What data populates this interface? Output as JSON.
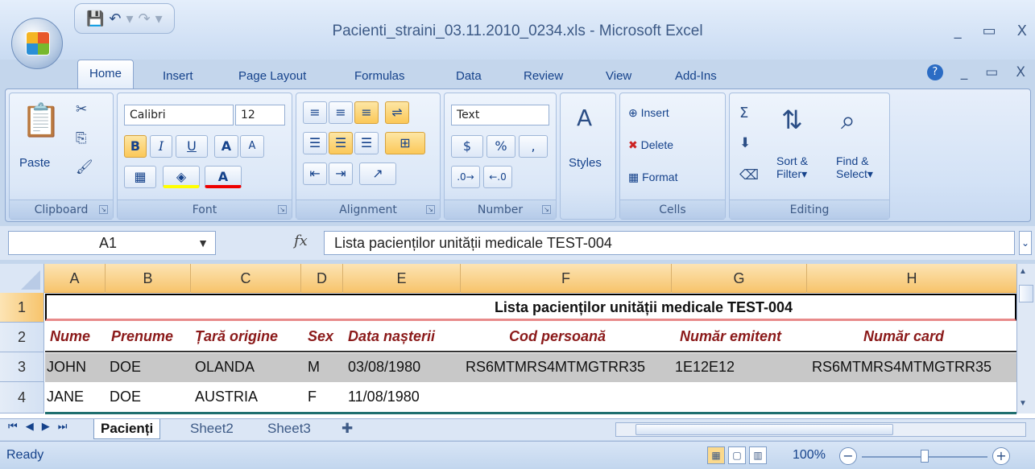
{
  "window": {
    "title": "Pacienti_straini_03.11.2010_0234.xls - Microsoft Excel",
    "min": "_",
    "max": "▭",
    "close": "X"
  },
  "qat": {
    "save_icon": "💾",
    "undo_icon": "↶",
    "redo_icon": "↷",
    "dropdown": "▾"
  },
  "tabs": [
    "Home",
    "Insert",
    "Page Layout",
    "Formulas",
    "Data",
    "Review",
    "View",
    "Add-Ins"
  ],
  "ribbon": {
    "clipboard": {
      "label": "Clipboard",
      "paste": "Paste"
    },
    "font": {
      "label": "Font",
      "name": "Calibri",
      "size": "12",
      "bold": "B",
      "italic": "I",
      "underline": "U",
      "grow": "A",
      "shrink": "A"
    },
    "alignment": {
      "label": "Alignment"
    },
    "number": {
      "label": "Number",
      "format": "Text",
      "currency": "$",
      "percent": "%",
      "comma": ","
    },
    "styles": {
      "label": "Styles"
    },
    "cells": {
      "label": "Cells",
      "insert": "Insert",
      "delete": "Delete",
      "format": "Format"
    },
    "editing": {
      "label": "Editing",
      "sum": "Σ",
      "sort": "Sort &",
      "sort2": "Filter",
      "find": "Find &",
      "find2": "Select"
    }
  },
  "formula_bar": {
    "name_box": "A1",
    "fx": "fx",
    "value": "Lista pacienților unității medicale TEST-004"
  },
  "columns": [
    "A",
    "B",
    "C",
    "D",
    "E",
    "F",
    "G",
    "H"
  ],
  "rows": [
    "1",
    "2",
    "3",
    "4"
  ],
  "sheet": {
    "title": "Lista pacienților unității medicale TEST-004",
    "headers": [
      "Nume",
      "Prenume",
      "Țară origine",
      "Sex",
      "Data nașterii",
      "Cod persoană",
      "Număr emitent",
      "Număr card"
    ],
    "data": [
      [
        "JOHN",
        "DOE",
        "OLANDA",
        "M",
        "03/08/1980",
        "RS6MTMRS4MTMGTRR35",
        "1E12E12",
        "RS6MTMRS4MTMGTRR35"
      ],
      [
        "JANE",
        "DOE",
        "AUSTRIA",
        "F",
        "11/08/1980",
        "",
        "",
        ""
      ]
    ]
  },
  "sheet_tabs": [
    "Pacienți",
    "Sheet2",
    "Sheet3"
  ],
  "status": {
    "ready": "Ready",
    "zoom": "100%",
    "minus": "−",
    "plus": "+"
  },
  "colors": {
    "accent": "#f7c46c",
    "header_text": "#8b1a1a",
    "ribbon": "#d3e2f6"
  }
}
